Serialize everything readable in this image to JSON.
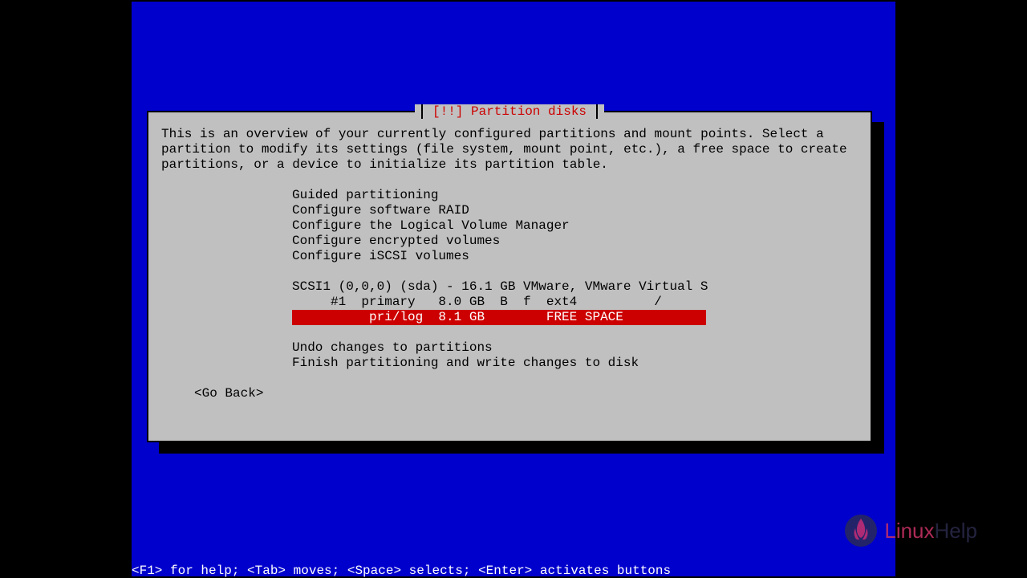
{
  "dialog": {
    "title": "[!!] Partition disks",
    "description": "This is an overview of your currently configured partitions and mount points. Select a partition to modify its settings (file system, mount point, etc.), a free space to create partitions, or a device to initialize its partition table."
  },
  "menu": {
    "items": [
      "Guided partitioning",
      "Configure software RAID",
      "Configure the Logical Volume Manager",
      "Configure encrypted volumes",
      "Configure iSCSI volumes"
    ],
    "disk_header": "SCSI1 (0,0,0) (sda) - 16.1 GB VMware, VMware Virtual S",
    "partition_1": "     #1  primary   8.0 GB  B  f  ext4          /",
    "free_space": "          pri/log  8.1 GB        FREE SPACE",
    "bottom_items": [
      "Undo changes to partitions",
      "Finish partitioning and write changes to disk"
    ],
    "go_back": "<Go Back>"
  },
  "help_bar": "<F1> for help; <Tab> moves; <Space> selects; <Enter> activates buttons",
  "logo": {
    "text1": "Linux",
    "text2": "Help"
  }
}
